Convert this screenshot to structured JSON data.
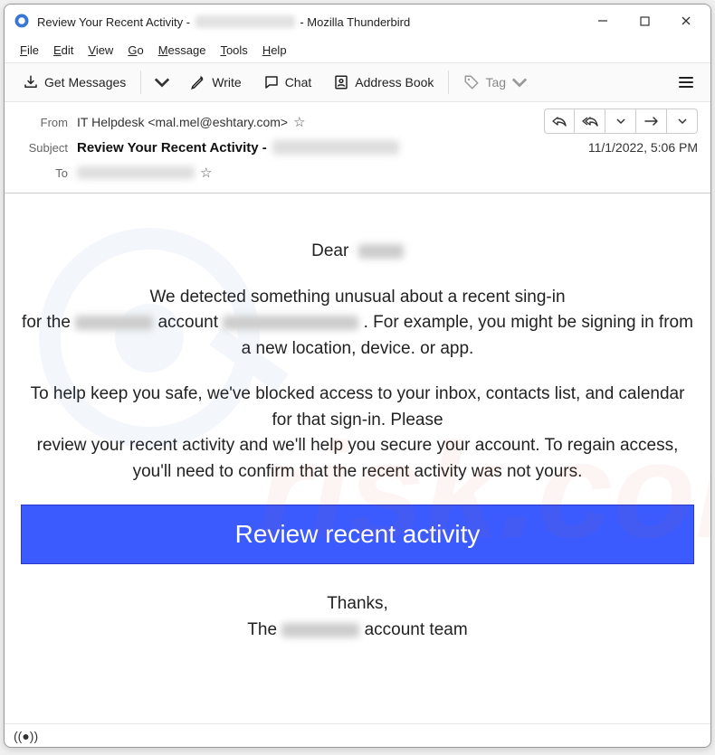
{
  "titlebar": {
    "prefix": "Review Your Recent Activity - ",
    "suffix": " - Mozilla Thunderbird"
  },
  "menubar": {
    "file": "File",
    "edit": "Edit",
    "view": "View",
    "go": "Go",
    "message": "Message",
    "tools": "Tools",
    "help": "Help"
  },
  "toolbar": {
    "get_messages": "Get Messages",
    "write": "Write",
    "chat": "Chat",
    "address_book": "Address Book",
    "tag": "Tag"
  },
  "headers": {
    "labels": {
      "from": "From",
      "subject": "Subject",
      "to": "To"
    },
    "from_value": "IT Helpdesk <mal.mel@eshtary.com>",
    "subject_prefix": "Review Your Recent Activity - ",
    "date": "11/1/2022, 5:06 PM"
  },
  "email": {
    "greeting": "Dear",
    "p1_a": "We detected something unusual about a recent sing-in",
    "p1_b": "for the",
    "p1_c": "account",
    "p1_d": ". For example, you might be signing in from a new location, device. or app.",
    "p2_a": "To help keep you safe, we've blocked access to your inbox, contacts list, and calendar for that sign-in. Please",
    "p2_b": "review your recent activity and we'll help you secure your account. To regain access, you'll need to confirm that the recent activity was not yours.",
    "button": "Review recent activity",
    "thanks": "Thanks,",
    "sig_a": "The",
    "sig_b": "account team"
  }
}
